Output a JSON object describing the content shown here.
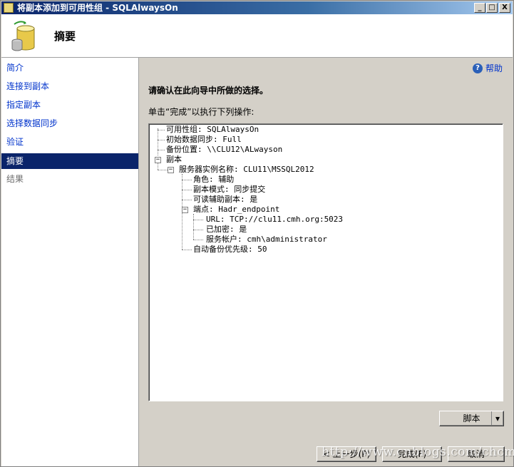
{
  "window": {
    "title": "将副本添加到可用性组 - SQLAlwaysOn",
    "controls": {
      "minimize": "_",
      "maximize": "□",
      "close": "X"
    }
  },
  "header": {
    "title": "摘要",
    "icon": "database-icon"
  },
  "sidebar": {
    "items": [
      {
        "label": "简介",
        "state": "link"
      },
      {
        "label": "连接到副本",
        "state": "link"
      },
      {
        "label": "指定副本",
        "state": "link"
      },
      {
        "label": "选择数据同步",
        "state": "link"
      },
      {
        "label": "验证",
        "state": "link"
      },
      {
        "label": "摘要",
        "state": "active"
      },
      {
        "label": "结果",
        "state": "disabled"
      }
    ]
  },
  "content": {
    "help_label": "帮助",
    "confirm_text": "请确认在此向导中所做的选择。",
    "instruction_text": "单击“完成”以执行下列操作:",
    "tree": [
      {
        "text": "可用性组: SQLAlwaysOn",
        "level": 0,
        "expander": "none"
      },
      {
        "text": "初始数据同步: Full",
        "level": 0,
        "expander": "none"
      },
      {
        "text": "备份位置: \\\\CLU12\\ALwayson",
        "level": 0,
        "expander": "none"
      },
      {
        "text": "副本",
        "level": 0,
        "expander": "minus"
      },
      {
        "text": "服务器实例名称: CLU11\\MSSQL2012",
        "level": 1,
        "expander": "minus"
      },
      {
        "text": "角色: 辅助",
        "level": 2,
        "expander": "none"
      },
      {
        "text": "副本模式: 同步提交",
        "level": 2,
        "expander": "none"
      },
      {
        "text": "可读辅助副本: 是",
        "level": 2,
        "expander": "none"
      },
      {
        "text": "端点: Hadr_endpoint",
        "level": 2,
        "expander": "minus"
      },
      {
        "text": "URL: TCP://clu11.cmh.org:5023",
        "level": 3,
        "expander": "none"
      },
      {
        "text": "已加密: 是",
        "level": 3,
        "expander": "none"
      },
      {
        "text": "服务帐户: cmh\\administrator",
        "level": 3,
        "expander": "none"
      },
      {
        "text": "自动备份优先级: 50",
        "level": 2,
        "expander": "none"
      }
    ]
  },
  "buttons": {
    "script": "脚本",
    "script_dropdown": "▾",
    "previous": "< 上一步(P)",
    "finish": "完成(F)",
    "cancel": "取消"
  },
  "watermark": "http://www.cnblogs.com/chcmh/"
}
